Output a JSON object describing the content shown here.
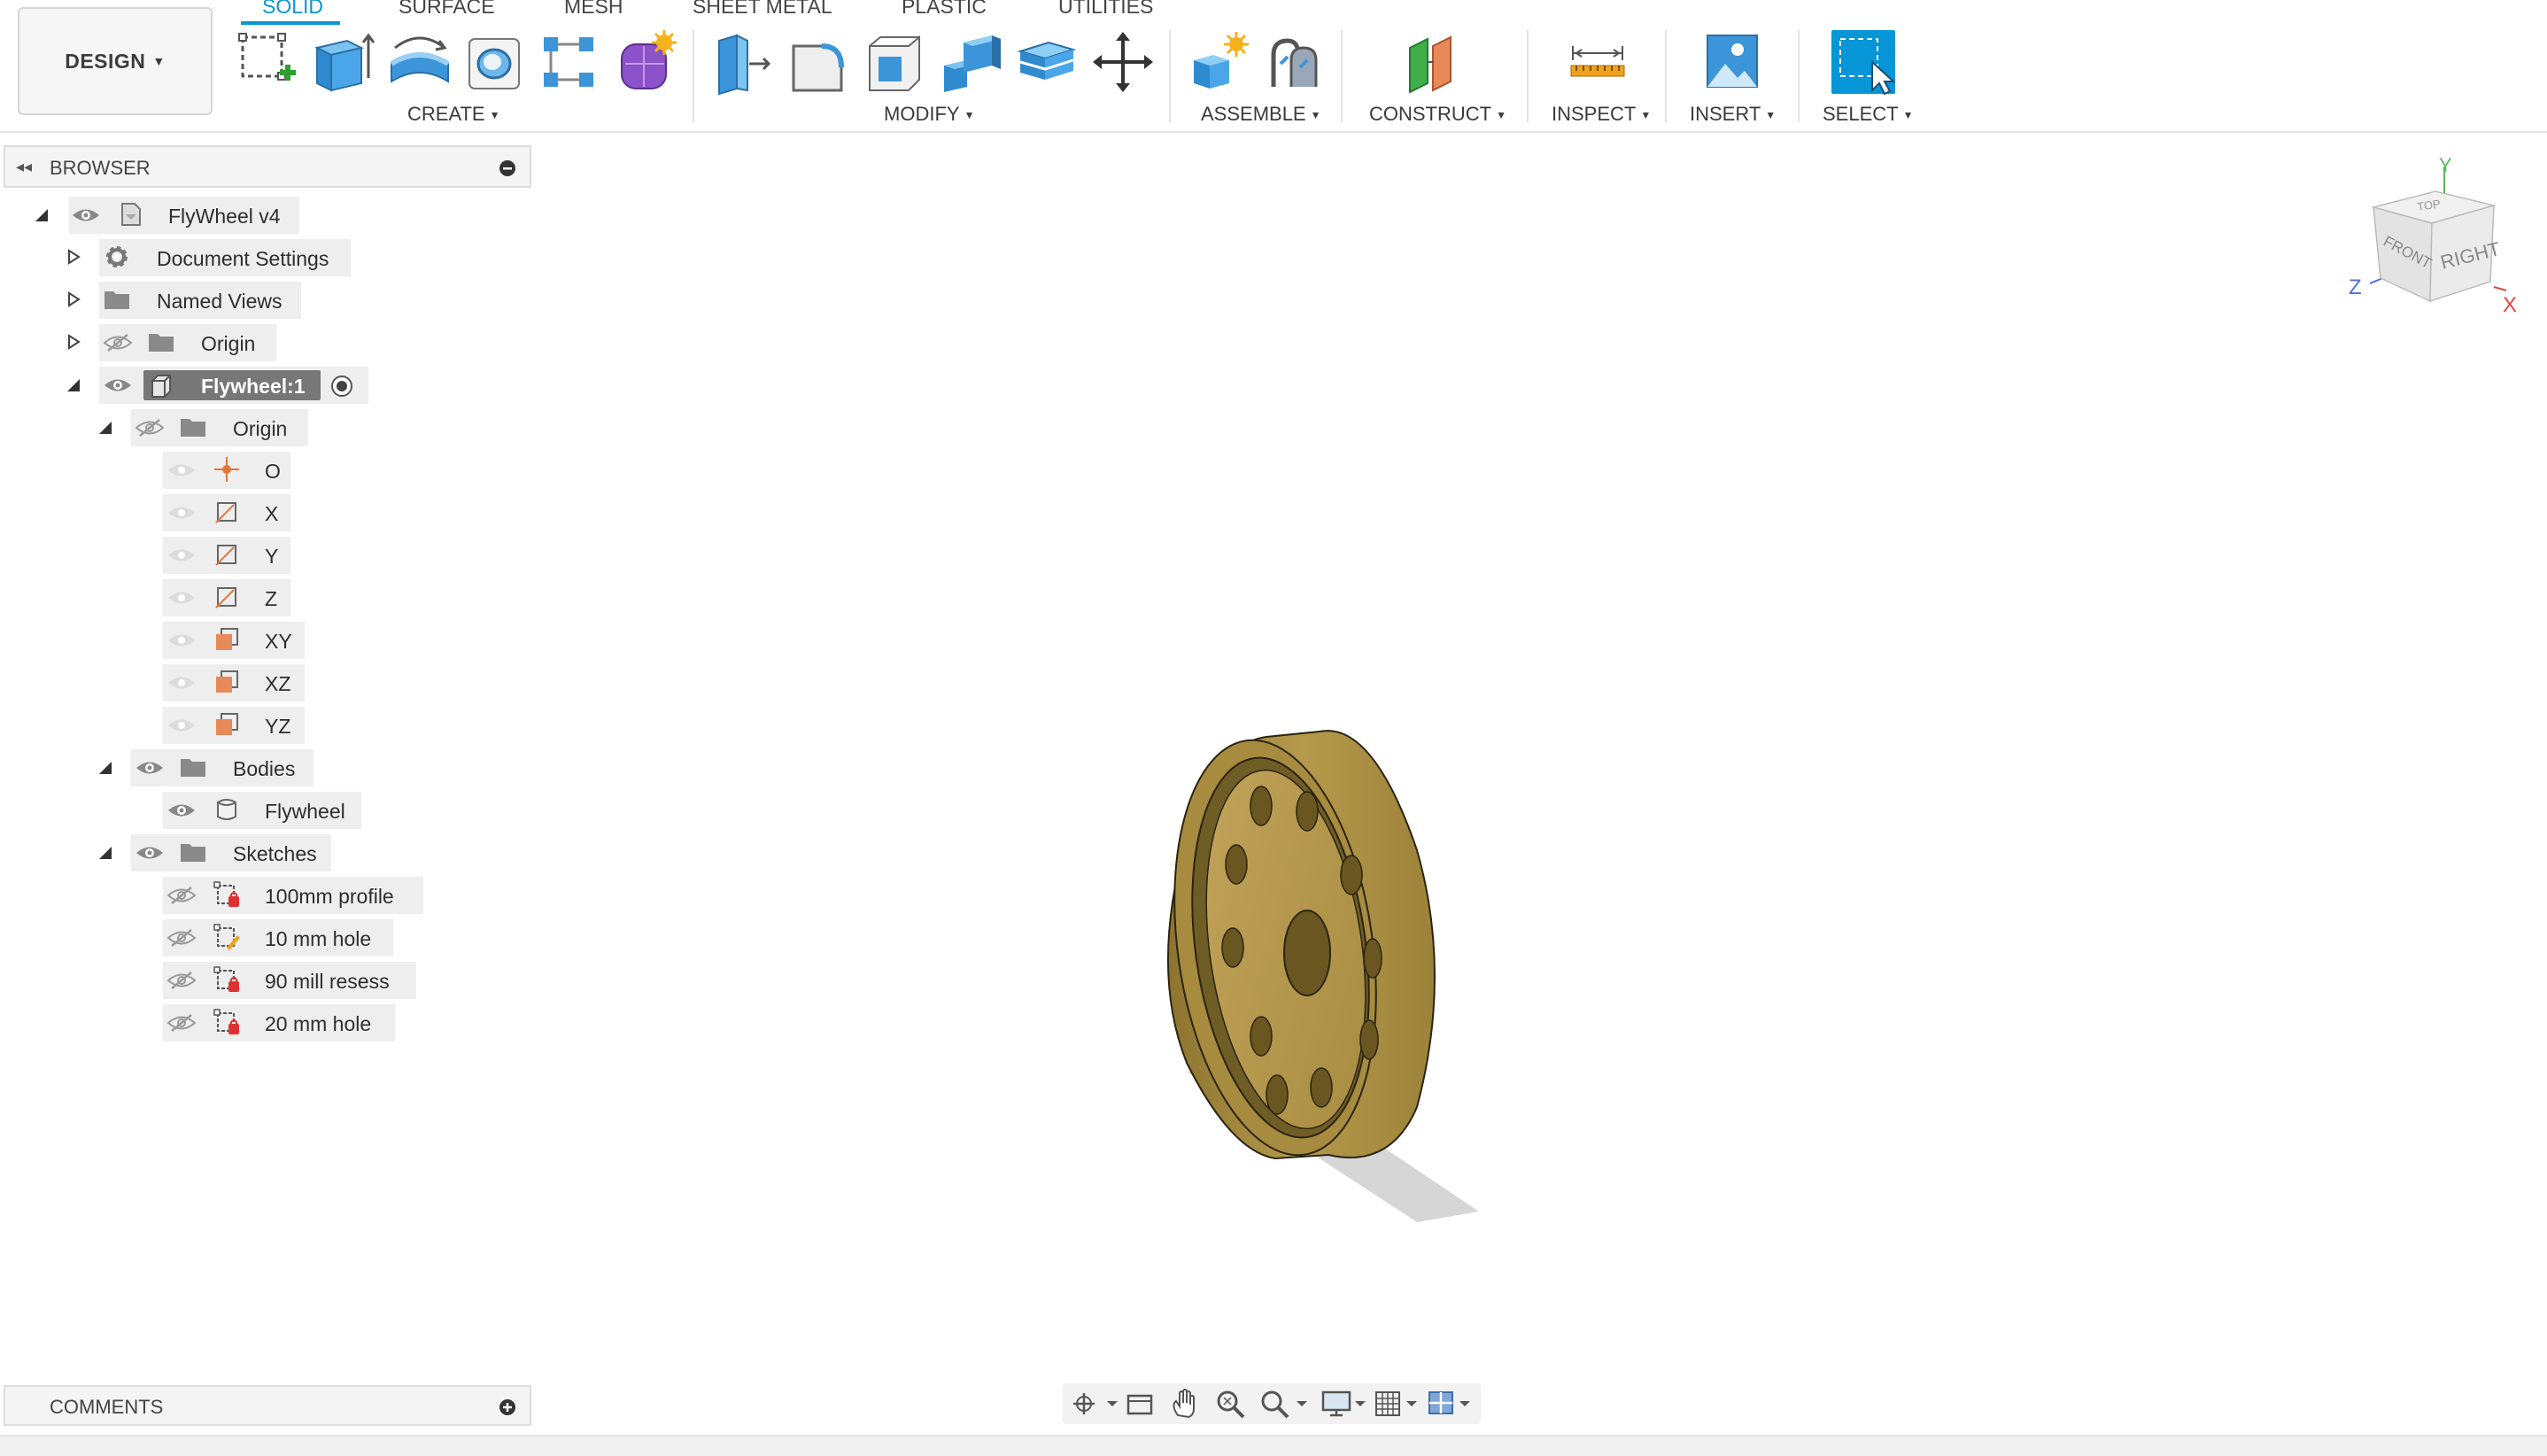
{
  "workspace": {
    "label": "DESIGN"
  },
  "tabs": [
    {
      "label": "SOLID",
      "active": true
    },
    {
      "label": "SURFACE",
      "active": false
    },
    {
      "label": "MESH",
      "active": false
    },
    {
      "label": "SHEET METAL",
      "active": false
    },
    {
      "label": "PLASTIC",
      "active": false
    },
    {
      "label": "UTILITIES",
      "active": false
    }
  ],
  "toolbar": {
    "create": {
      "label": "CREATE",
      "icons": [
        "create-sketch-icon",
        "extrude-icon",
        "revolve-icon",
        "hole-icon",
        "pattern-icon",
        "create-form-icon"
      ]
    },
    "modify": {
      "label": "MODIFY",
      "icons": [
        "press-pull-icon",
        "fillet-icon",
        "shell-icon",
        "combine-icon",
        "offset-face-icon",
        "move-icon"
      ]
    },
    "assemble": {
      "label": "ASSEMBLE",
      "icons": [
        "new-component-icon",
        "joint-icon"
      ]
    },
    "construct": {
      "label": "CONSTRUCT",
      "icons": [
        "offset-plane-icon"
      ]
    },
    "inspect": {
      "label": "INSPECT",
      "icons": [
        "measure-icon"
      ]
    },
    "insert": {
      "label": "INSERT",
      "icons": [
        "insert-image-icon"
      ]
    },
    "select": {
      "label": "SELECT",
      "icons": [
        "select-icon"
      ]
    }
  },
  "browser": {
    "title": "BROWSER",
    "items": [
      {
        "label": "FlyWheel v4"
      },
      {
        "label": "Document Settings"
      },
      {
        "label": "Named Views"
      },
      {
        "label": "Origin"
      },
      {
        "label": "Flywheel:1"
      },
      {
        "label": "Origin"
      },
      {
        "label": "O"
      },
      {
        "label": "X"
      },
      {
        "label": "Y"
      },
      {
        "label": "Z"
      },
      {
        "label": "XY"
      },
      {
        "label": "XZ"
      },
      {
        "label": "YZ"
      },
      {
        "label": "Bodies"
      },
      {
        "label": "Flywheel"
      },
      {
        "label": "Sketches"
      },
      {
        "label": "100mm profile"
      },
      {
        "label": "10 mm hole"
      },
      {
        "label": "90 mill resess"
      },
      {
        "label": "20 mm hole"
      }
    ]
  },
  "viewcube": {
    "front": "FRONT",
    "right": "RIGHT",
    "top": "TOP",
    "axis_x": "X",
    "axis_y": "Y",
    "axis_z": "Z"
  },
  "comments": {
    "title": "COMMENTS"
  },
  "colors": {
    "accent": "#0696d7",
    "part": "#b09545",
    "axis_x": "#e0483d",
    "axis_y": "#5cb85c",
    "axis_z": "#4a6fdc"
  }
}
